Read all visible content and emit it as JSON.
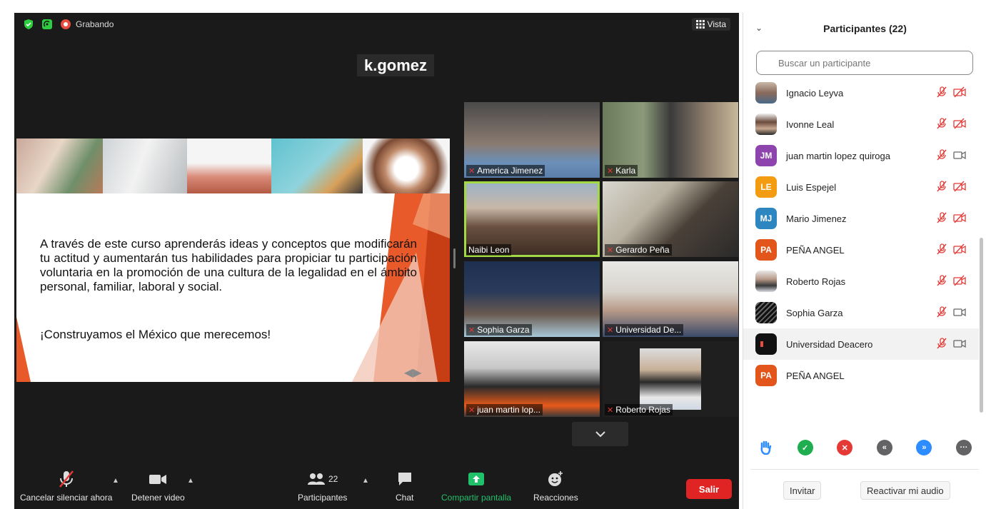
{
  "recording": {
    "label": "Grabando"
  },
  "view": {
    "label": "Vista"
  },
  "active_speaker": {
    "name": "k.gomez"
  },
  "slide": {
    "body": "A través de este curso aprenderás ideas y conceptos que modificarán tu actitud y aumentarán tus habilidades para propiciar tu participación voluntaria en la promoción de una cultura de la legalidad en el ámbito personal, familiar, laboral y social.",
    "cta": "¡Construyamos el México que merecemos!",
    "arrows": "◀▶"
  },
  "video_tiles": [
    {
      "name": "America Jimenez"
    },
    {
      "name": "Karla"
    },
    {
      "name": "Naibi Leon"
    },
    {
      "name": "Gerardo Peña"
    },
    {
      "name": "Sophia Garza"
    },
    {
      "name": "Universidad De..."
    },
    {
      "name": "juan martin lop..."
    },
    {
      "name": "Roberto Rojas"
    }
  ],
  "toolbar": {
    "mute": "Cancelar silenciar ahora",
    "video": "Detener video",
    "participants": "Participantes",
    "participants_count": "22",
    "chat": "Chat",
    "share": "Compartir pantalla",
    "reactions": "Reacciones",
    "leave": "Salir"
  },
  "panel": {
    "title": "Participantes (22)",
    "search_placeholder": "Buscar un participante",
    "participants": [
      {
        "name": "Ignacio Leyva",
        "initials": "",
        "color": "#8a7a6a"
      },
      {
        "name": "Ivonne Leal",
        "initials": "",
        "color": "#7a5e4a"
      },
      {
        "name": "juan martin lopez quiroga",
        "initials": "JM",
        "color": "#8e44ad"
      },
      {
        "name": "Luis Espejel",
        "initials": "LE",
        "color": "#f39c12"
      },
      {
        "name": "Mario Jimenez",
        "initials": "MJ",
        "color": "#2e86c1"
      },
      {
        "name": "PEÑA ANGEL",
        "initials": "PA",
        "color": "#e2561b"
      },
      {
        "name": "Roberto Rojas",
        "initials": "",
        "color": "#6a7a8a"
      },
      {
        "name": "Sophia Garza",
        "initials": "",
        "color": "#333333"
      },
      {
        "name": "Universidad Deacero",
        "initials": "",
        "color": "#111111"
      },
      {
        "name": "PEÑA ANGEL",
        "initials": "PA",
        "color": "#e2561b"
      }
    ],
    "invite": "Invitar",
    "unmute_audio": "Reactivar mi audio"
  }
}
